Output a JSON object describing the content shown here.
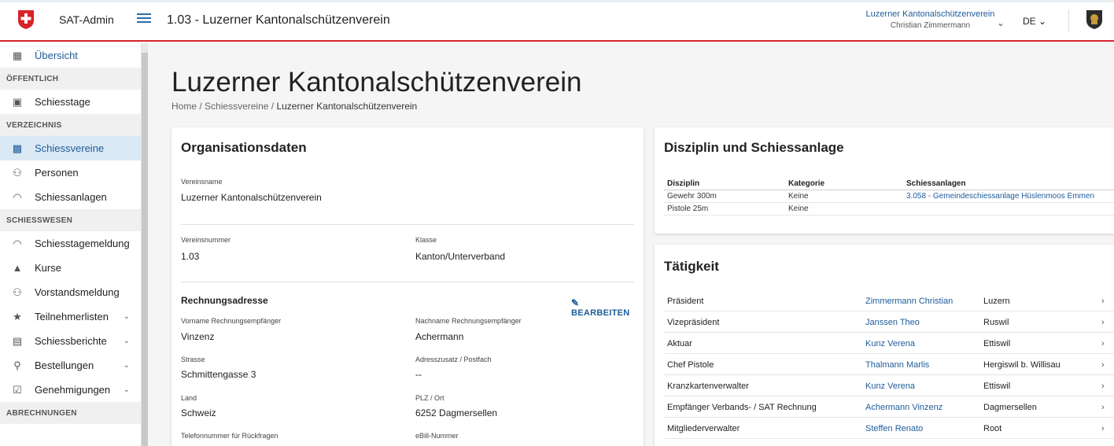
{
  "header": {
    "app_name": "SAT-Admin",
    "page_title": "1.03 - Luzerner Kantonalschützenverein",
    "org_name": "Luzerner Kantonalschützenverein",
    "user_name": "Christian Zimmermann",
    "language": "DE"
  },
  "sidebar": {
    "overview": "Übersicht",
    "sections": {
      "public": "ÖFFENTLICH",
      "directory": "VERZEICHNIS",
      "shooting": "SCHIESSWESEN",
      "billing": "ABRECHNUNGEN"
    },
    "items": {
      "schiesstage": "Schiesstage",
      "schiessvereine": "Schiessvereine",
      "personen": "Personen",
      "schiessanlagen": "Schiessanlagen",
      "schiesstagemeldung": "Schiesstagemeldung",
      "kurse": "Kurse",
      "vorstandsmeldung": "Vorstandsmeldung",
      "teilnehmerlisten": "Teilnehmerlisten",
      "schiessberichte": "Schiessberichte",
      "bestellungen": "Bestellungen",
      "genehmigungen": "Genehmigungen"
    }
  },
  "main": {
    "title": "Luzerner Kantonalschützenverein",
    "breadcrumb": {
      "home": "Home",
      "sep": "/",
      "clubs": "Schiessvereine",
      "current": "Luzerner Kantonalschützenverein"
    }
  },
  "org": {
    "title": "Organisationsdaten",
    "vereinsname_label": "Vereinsname",
    "vereinsname": "Luzerner Kantonalschützenverein",
    "vereinsnummer_label": "Vereinsnummer",
    "vereinsnummer": "1.03",
    "klasse_label": "Klasse",
    "klasse": "Kanton/Unterverband",
    "billing_title": "Rechnungsadresse",
    "edit_label": "BEARBEITEN",
    "vorname_label": "Vorname Rechnungsempfänger",
    "vorname": "Vinzenz",
    "nachname_label": "Nachname Rechnungsempfänger",
    "nachname": "Achermann",
    "strasse_label": "Strasse",
    "strasse": "Schmittengasse 3",
    "zusatz_label": "Adresszusatz / Postfach",
    "zusatz": "--",
    "land_label": "Land",
    "land": "Schweiz",
    "plz_label": "PLZ / Ort",
    "plz": "6252 Dagmersellen",
    "telefon_label": "Telefonnummer für Rückfragen",
    "ebill_label": "eBill-Nummer"
  },
  "discipline": {
    "title": "Disziplin und Schiessanlage",
    "headers": [
      "Disziplin",
      "Kategorie",
      "Schiessanlagen"
    ],
    "rows": [
      {
        "disziplin": "Gewehr 300m",
        "kategorie": "Keine",
        "anlage": "3.058 - Gemeindeschiessanlage Hüslenmoos Emmen"
      },
      {
        "disziplin": "Pistole 25m",
        "kategorie": "Keine",
        "anlage": ""
      }
    ]
  },
  "activity": {
    "title": "Tätigkeit",
    "rows": [
      {
        "role": "Präsident",
        "person": "Zimmermann Christian",
        "place": "Luzern"
      },
      {
        "role": "Vizepräsident",
        "person": "Janssen Theo",
        "place": "Ruswil"
      },
      {
        "role": "Aktuar",
        "person": "Kunz Verena",
        "place": "Ettiswil"
      },
      {
        "role": "Chef Pistole",
        "person": "Thalmann Marlis",
        "place": "Hergiswil b. Willisau"
      },
      {
        "role": "Kranzkartenverwalter",
        "person": "Kunz Verena",
        "place": "Ettiswil"
      },
      {
        "role": "Empfänger Verbands- / SAT Rechnung",
        "person": "Achermann Vinzenz",
        "place": "Dagmersellen"
      },
      {
        "role": "Mitgliederverwalter",
        "person": "Steffen Renato",
        "place": "Root"
      }
    ]
  },
  "colors": {
    "accent": "#1f5c99",
    "brand_red": "#d8232a",
    "active_bg": "#dbe9f5"
  }
}
